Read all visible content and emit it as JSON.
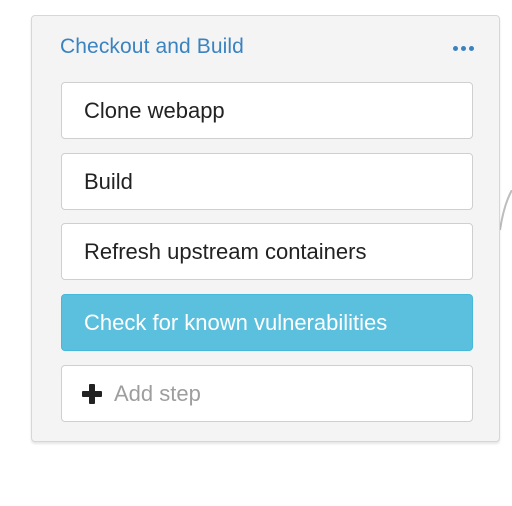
{
  "stage": {
    "title": "Checkout and Build",
    "more_icon": "ellipsis-icon",
    "steps": [
      {
        "label": "Clone webapp",
        "active": false
      },
      {
        "label": "Build",
        "active": false
      },
      {
        "label": "Refresh upstream containers",
        "active": false
      },
      {
        "label": "Check for known vulnerabilities",
        "active": true
      }
    ],
    "add_step": {
      "icon": "plus-icon",
      "label": "Add step"
    }
  },
  "colors": {
    "accent": "#3a83c1",
    "active_step": "#5bc0de",
    "panel_bg": "#f4f4f4"
  }
}
